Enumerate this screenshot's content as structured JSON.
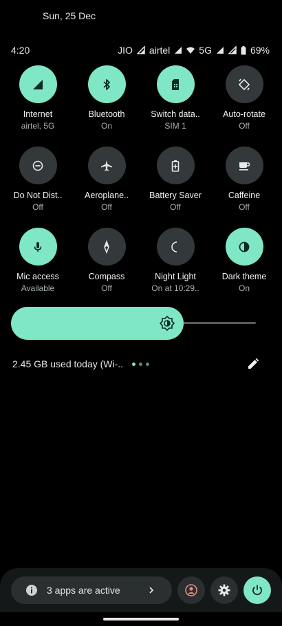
{
  "header": {
    "date": "Sun, 25 Dec"
  },
  "status_bar": {
    "time": "4:20",
    "carrier1": "JIO",
    "carrier2": "airtel",
    "network": "5G",
    "battery": "69%"
  },
  "tiles": [
    {
      "label": "Internet",
      "sub": "airtel, 5G",
      "state": "on",
      "icon": "signal-icon"
    },
    {
      "label": "Bluetooth",
      "sub": "On",
      "state": "on",
      "icon": "bluetooth-icon"
    },
    {
      "label": "Switch data..",
      "sub": "SIM 1",
      "state": "on",
      "icon": "sim-icon"
    },
    {
      "label": "Auto-rotate",
      "sub": "Off",
      "state": "off",
      "icon": "rotate-icon"
    },
    {
      "label": "Do Not Dist..",
      "sub": "Off",
      "state": "off",
      "icon": "do-not-disturb-icon"
    },
    {
      "label": "Aeroplane..",
      "sub": "Off",
      "state": "off",
      "icon": "airplane-icon"
    },
    {
      "label": "Battery Saver",
      "sub": "Off",
      "state": "off",
      "icon": "battery-saver-icon"
    },
    {
      "label": "Caffeine",
      "sub": "Off",
      "state": "off",
      "icon": "coffee-icon"
    },
    {
      "label": "Mic access",
      "sub": "Available",
      "state": "on",
      "icon": "mic-icon"
    },
    {
      "label": "Compass",
      "sub": "Off",
      "state": "off",
      "icon": "compass-icon"
    },
    {
      "label": "Night Light",
      "sub": "On at 10:29..",
      "state": "off",
      "icon": "moon-icon"
    },
    {
      "label": "Dark theme",
      "sub": "On",
      "state": "on",
      "icon": "contrast-icon"
    }
  ],
  "brightness": {
    "level": 0.66
  },
  "usage": {
    "text": "2.45 GB used today (Wi-.."
  },
  "pager": {
    "pages": 3,
    "active": 0
  },
  "bottom": {
    "apps_text": "3 apps are active"
  },
  "colors": {
    "accent": "#7fe6c6",
    "tile_off": "#33393b",
    "background": "#000000"
  }
}
